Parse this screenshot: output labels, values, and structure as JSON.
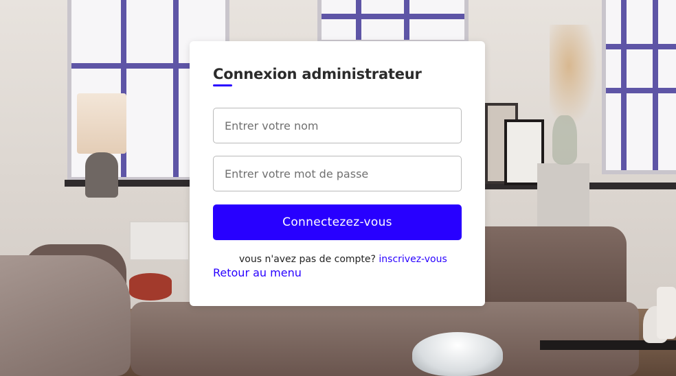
{
  "login": {
    "title": "Connexion administrateur",
    "username_placeholder": "Entrer votre nom",
    "password_placeholder": "Entrer votre mot de passe",
    "submit_label": "Connectezez-vous",
    "no_account_text": "vous n'avez pas de compte?",
    "signup_link": "inscrivez-vous",
    "back_link": "Retour au menu"
  },
  "colors": {
    "accent": "#2800ff",
    "card_background": "#ffffff",
    "title_text": "#2b2b2b"
  }
}
